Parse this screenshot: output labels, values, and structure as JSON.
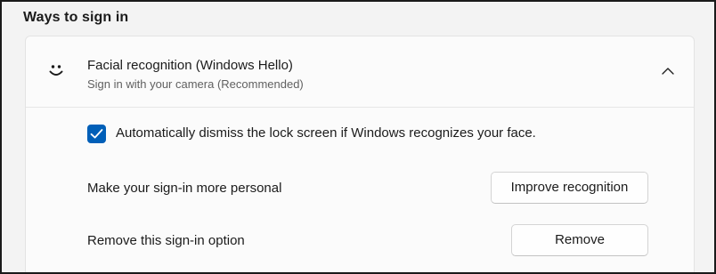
{
  "section": {
    "title": "Ways to sign in"
  },
  "facial_card": {
    "icon": "smiley-face-icon",
    "title": "Facial recognition (Windows Hello)",
    "subtitle": "Sign in with your camera (Recommended)",
    "expanded": true,
    "auto_dismiss": {
      "checked": true,
      "label": "Automatically dismiss the lock screen if Windows recognizes your face."
    },
    "personalize": {
      "label": "Make your sign-in more personal",
      "button_label": "Improve recognition"
    },
    "remove": {
      "label": "Remove this sign-in option",
      "button_label": "Remove"
    }
  },
  "colors": {
    "accent": "#005fb8",
    "card_bg": "#fbfbfb",
    "page_bg": "#f3f3f3"
  }
}
